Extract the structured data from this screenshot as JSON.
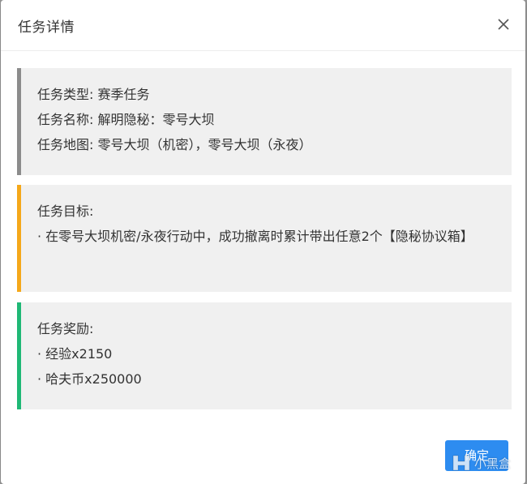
{
  "dialog": {
    "title": "任务详情",
    "confirm_label": "确定",
    "watermark_text": "小黑盒"
  },
  "info": {
    "type": "任务类型: 赛季任务",
    "name": "任务名称: 解明隐秘：零号大坝",
    "map": "任务地图: 零号大坝（机密），零号大坝（永夜）"
  },
  "goal": {
    "heading": "任务目标:",
    "text": "· 在零号大坝机密/永夜行动中，成功撤离时累计带出任意2个【隐秘协议箱】"
  },
  "reward": {
    "heading": "任务奖励:",
    "items": [
      "· 经验x2150",
      "· 哈夫币x250000"
    ]
  },
  "colors": {
    "info_bar": "#8c8c8c",
    "goal_bar": "#f5a81a",
    "reward_bar": "#1fb876",
    "section_bg": "#f0f0f0",
    "button": "#2d8cf0"
  }
}
